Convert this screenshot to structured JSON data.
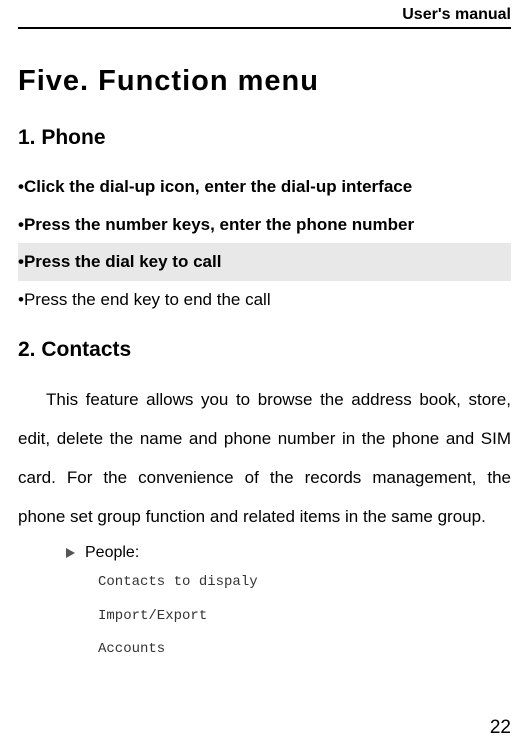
{
  "header": {
    "title": "User's manual"
  },
  "main_heading": "Five.  Function  menu",
  "sections": {
    "phone": {
      "heading": "1.  Phone",
      "bullets": [
        "•Click the dial-up icon, enter the dial-up interface",
        "•Press  the  number  keys, enter  the  phone  number",
        "•Press  the dial  key to call",
        "•Press the end  key to end  the  call"
      ]
    },
    "contacts": {
      "heading": "2.  Contacts",
      "paragraph": "This feature allows you to browse the address book, store, edit, delete the name and phone number in the phone and SIM card. For the convenience of the records management, the phone set group function and related items in the same group.",
      "people_label": "People:",
      "people_items": [
        "Contacts to dispaly",
        "Import/Export",
        "Accounts"
      ]
    }
  },
  "page_number": "22"
}
